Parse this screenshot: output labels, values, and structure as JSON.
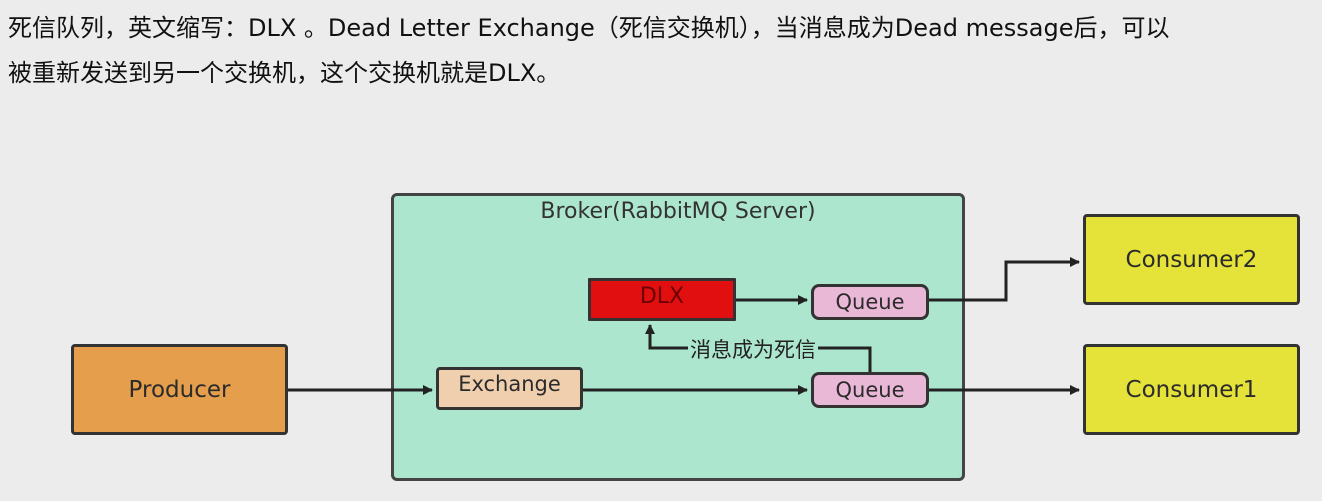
{
  "intro": {
    "line1": "死信队列，英文缩写：DLX  。Dead Letter Exchange（死信交换机），当消息成为Dead message后，可以",
    "line2": "被重新发送到另一个交换机，这个交换机就是DLX。"
  },
  "diagram": {
    "broker_label": "Broker(RabbitMQ Server)",
    "producer": "Producer",
    "exchange": "Exchange",
    "dlx": "DLX",
    "queue_top": "Queue",
    "queue_bottom": "Queue",
    "consumer2": "Consumer2",
    "consumer1": "Consumer1",
    "dead_letter_label": "消息成为死信"
  },
  "colors": {
    "broker": "#ade6cf",
    "producer": "#e59e4c",
    "consumer": "#e5e239",
    "exchange": "#f0cfae",
    "dlx": "#e10f0f",
    "queue": "#e9b8d6"
  }
}
